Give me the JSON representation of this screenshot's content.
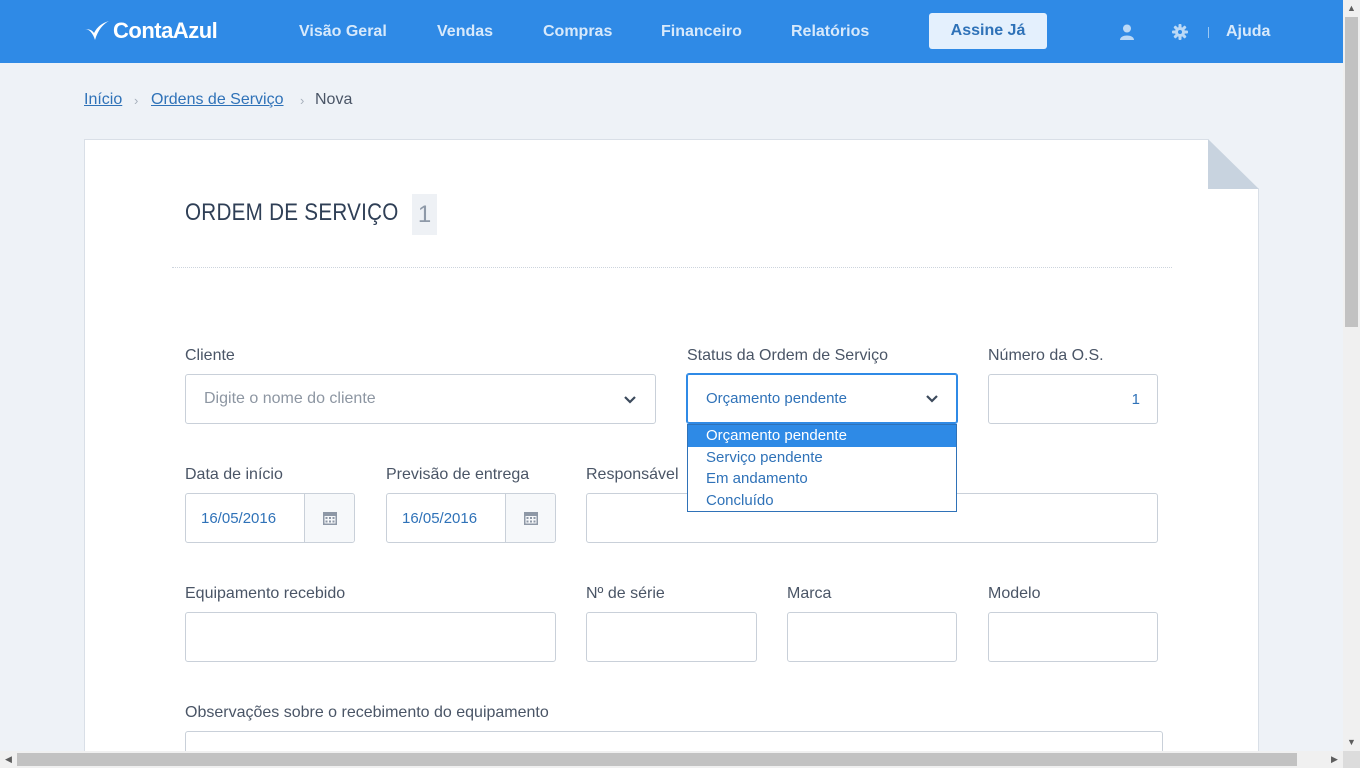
{
  "app": {
    "logo_text": "ContaAzul",
    "brand_color": "#2f8ae6",
    "accent_color": "#2f72b8"
  },
  "nav": {
    "items": [
      "Visão Geral",
      "Vendas",
      "Compras",
      "Financeiro",
      "Relatórios"
    ],
    "cta": "Assine Já",
    "help": "Ajuda",
    "icons": [
      "user-icon",
      "gear-icon"
    ]
  },
  "breadcrumb": {
    "home": "Início",
    "section": "Ordens de Serviço",
    "current": "Nova"
  },
  "form": {
    "title": "ORDEM DE SERVIÇO",
    "number_badge": "1",
    "client": {
      "label": "Cliente",
      "placeholder": "Digite o nome do cliente"
    },
    "status": {
      "label": "Status da Ordem de Serviço",
      "value": "Orçamento pendente",
      "options": [
        "Orçamento pendente",
        "Serviço pendente",
        "Em andamento",
        "Concluído"
      ]
    },
    "os_number": {
      "label": "Número da O.S.",
      "value": "1"
    },
    "start_date": {
      "label": "Data de início",
      "value": "16/05/2016"
    },
    "delivery_date": {
      "label": "Previsão de entrega",
      "value": "16/05/2016"
    },
    "responsible": {
      "label": "Responsável"
    },
    "equipment": {
      "label": "Equipamento recebido"
    },
    "serial": {
      "label": "Nº de série"
    },
    "brand": {
      "label": "Marca"
    },
    "model": {
      "label": "Modelo"
    },
    "notes": {
      "label": "Observações sobre o recebimento do equipamento"
    }
  }
}
